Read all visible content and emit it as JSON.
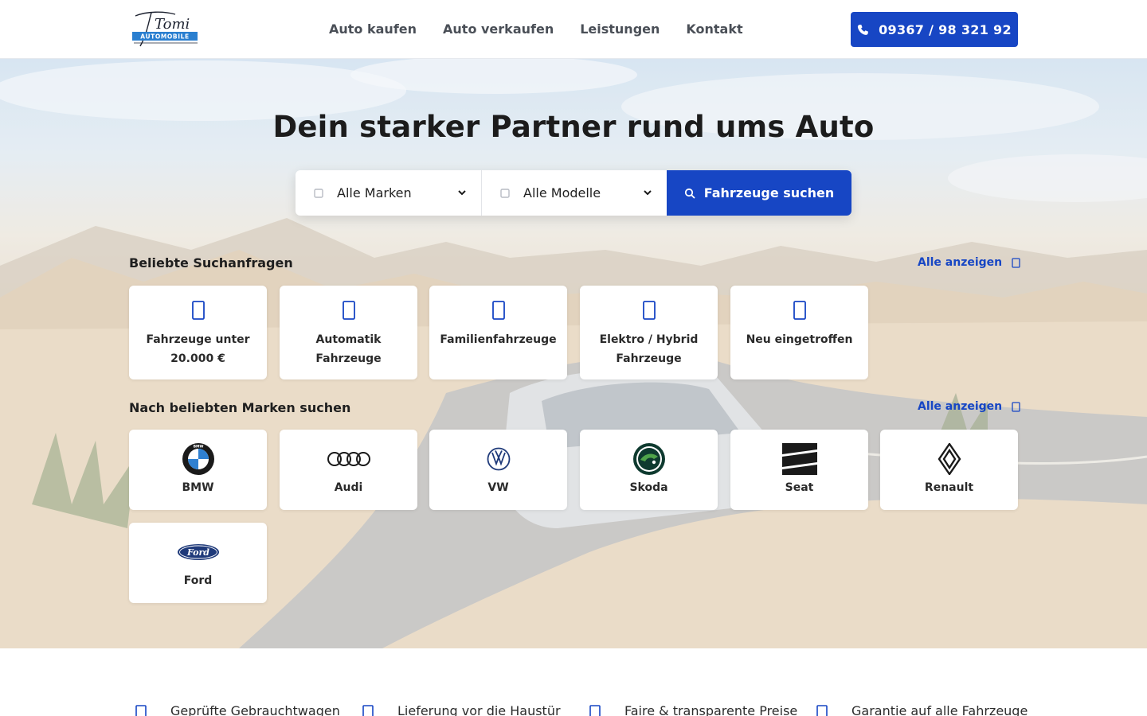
{
  "header": {
    "logo_alt": "Tomi Automobile",
    "logo_script": "Tomi",
    "logo_word": "AUTOMOBILE",
    "nav": [
      "Auto kaufen",
      "Auto verkaufen",
      "Leistungen",
      "Kontakt"
    ],
    "phone": "09367 / 98 321 92",
    "phone_icon": "phone-icon"
  },
  "hero": {
    "title": "Dein starker Partner rund ums Auto",
    "search": {
      "brand_select": "Alle Marken",
      "model_select": "Alle Modelle",
      "button": "Fahrzeuge suchen"
    }
  },
  "popular_searches": {
    "title": "Beliebte Suchanfragen",
    "see_all": "Alle anzeigen",
    "items": [
      {
        "label": "Fahrzeuge unter 20.000 €",
        "icon": "price-tag-icon"
      },
      {
        "label": "Automatik Fahrzeuge",
        "icon": "gearshift-icon"
      },
      {
        "label": "Familienfahrzeuge",
        "icon": "family-icon"
      },
      {
        "label": "Elektro / Hybrid Fahrzeuge",
        "icon": "charging-icon"
      },
      {
        "label": "Neu eingetroffen",
        "icon": "star-icon"
      }
    ]
  },
  "brands": {
    "title": "Nach beliebten Marken suchen",
    "see_all": "Alle anzeigen",
    "items": [
      {
        "label": "BMW",
        "logo_text": "BMW"
      },
      {
        "label": "Audi"
      },
      {
        "label": "VW"
      },
      {
        "label": "Skoda"
      },
      {
        "label": "Seat"
      },
      {
        "label": "Renault"
      },
      {
        "label": "Ford",
        "logo_text": "Ford"
      }
    ]
  },
  "usps": [
    "Geprüfte Gebrauchtwagen",
    "Lieferung vor die Haustür",
    "Faire & transparente Preise",
    "Garantie auf alle Fahrzeuge"
  ],
  "colors": {
    "accent": "#1746c4",
    "text": "#1c1c1c",
    "nav_text": "#4a4f57",
    "tile_bg": "#ffffff",
    "skoda_green": "#0e3a2f"
  }
}
